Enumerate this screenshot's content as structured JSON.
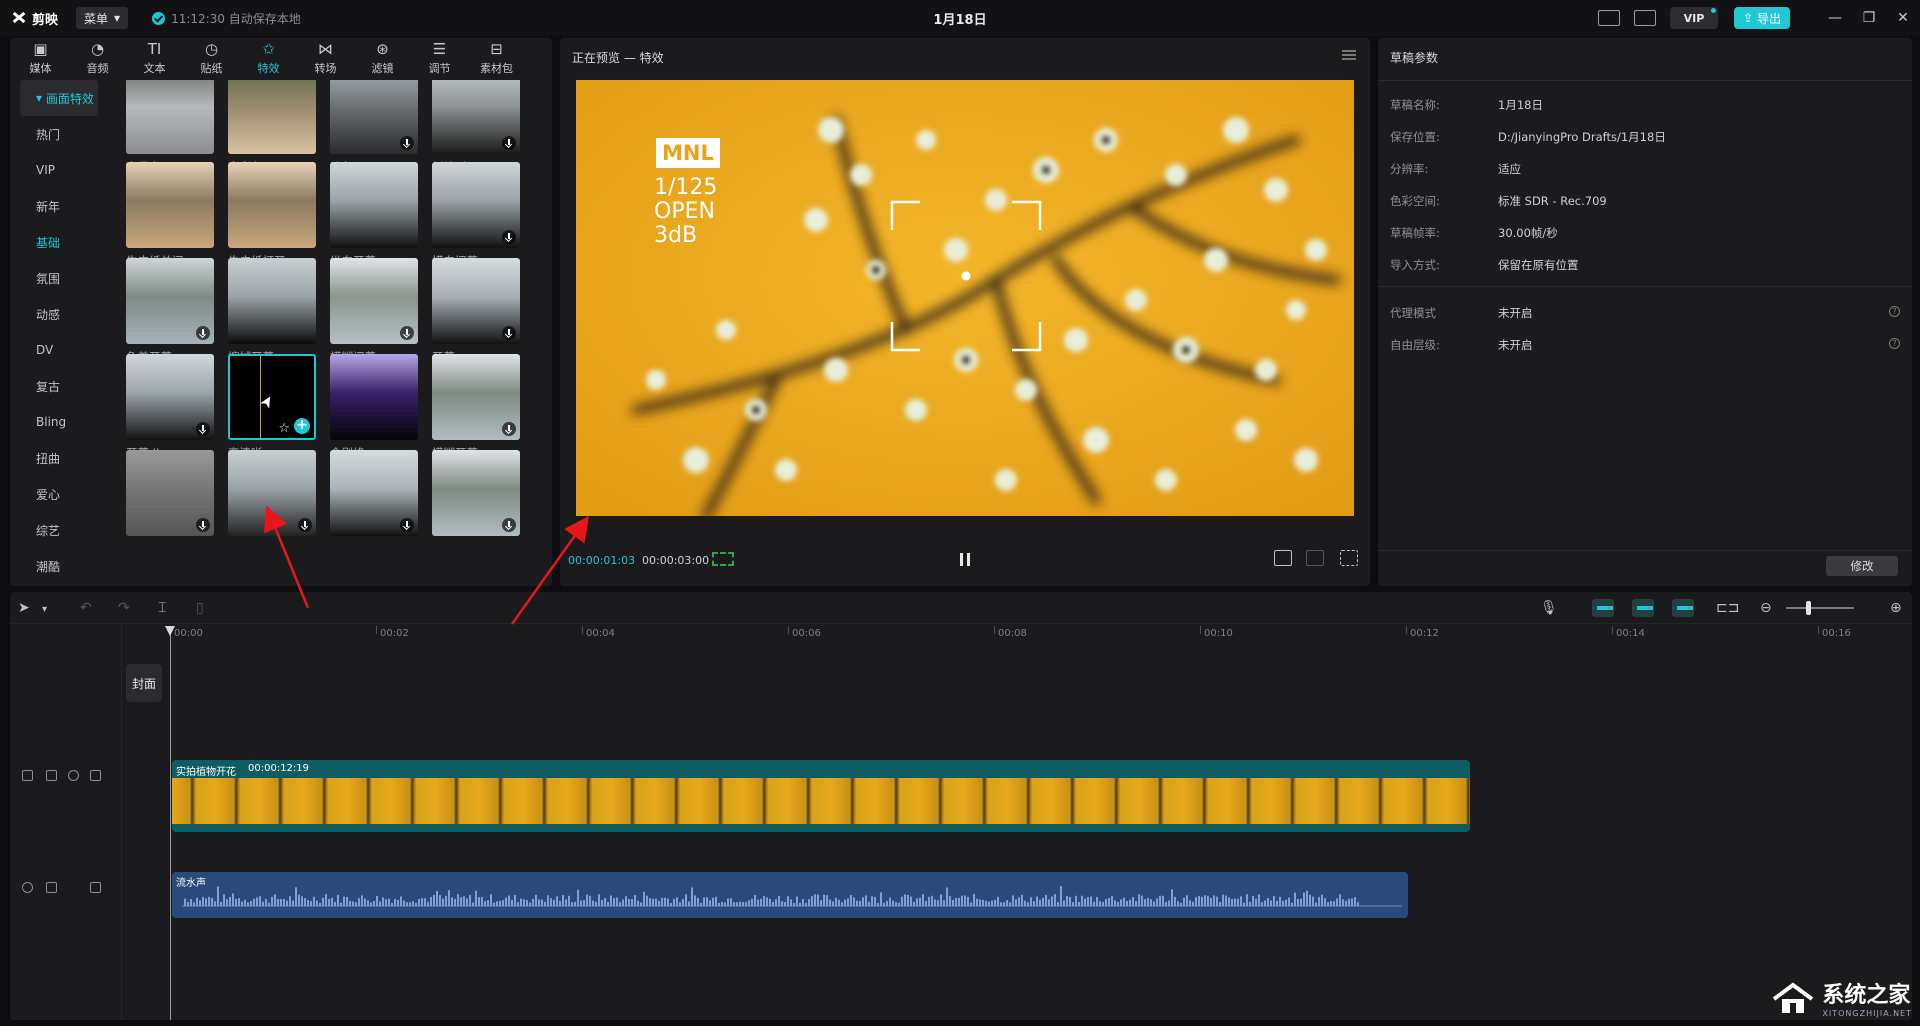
{
  "titlebar": {
    "app_name": "剪映",
    "menu_label": "菜单",
    "autosave_text": "11:12:30 自动保存本地",
    "doc_title": "1月18日",
    "vip_label": "VIP",
    "export_label": "导出"
  },
  "tool_tabs": [
    {
      "label": "媒体",
      "icon": "media-icon"
    },
    {
      "label": "音频",
      "icon": "audio-icon"
    },
    {
      "label": "文本",
      "icon": "text-icon"
    },
    {
      "label": "贴纸",
      "icon": "sticker-icon"
    },
    {
      "label": "特效",
      "icon": "effects-icon",
      "active": true
    },
    {
      "label": "转场",
      "icon": "transition-icon"
    },
    {
      "label": "滤镜",
      "icon": "filter-icon"
    },
    {
      "label": "调节",
      "icon": "adjust-icon"
    },
    {
      "label": "素材包",
      "icon": "asset-pack-icon"
    }
  ],
  "categories": {
    "selected": "画面特效",
    "items": [
      "热门",
      "VIP",
      "新年",
      "基础",
      "氛围",
      "动感",
      "DV",
      "复古",
      "Bling",
      "扭曲",
      "爱心",
      "综艺",
      "潮酷"
    ]
  },
  "effects": [
    {
      "label": "变黑白",
      "download": false
    },
    {
      "label": "变彩色",
      "download": false
    },
    {
      "label": "暗角",
      "download": true
    },
    {
      "label": "倒计时",
      "download": true
    },
    {
      "label": "牛皮纸关闭",
      "download": false
    },
    {
      "label": "牛皮纸打开",
      "download": false
    },
    {
      "label": "纵向开幕",
      "download": false
    },
    {
      "label": "横向闭幕",
      "download": true
    },
    {
      "label": "色差开幕",
      "download": true
    },
    {
      "label": "擦拭开幕",
      "download": false
    },
    {
      "label": "模糊闭幕",
      "download": true
    },
    {
      "label": "开幕",
      "download": true
    },
    {
      "label": "开幕 II",
      "download": true
    },
    {
      "label": "变清晰",
      "download": false,
      "selected": true
    },
    {
      "label": "全剧终",
      "download": false
    },
    {
      "label": "模糊开幕",
      "download": true
    },
    {
      "label": "",
      "download": true
    },
    {
      "label": "",
      "download": true
    },
    {
      "label": "",
      "download": true
    },
    {
      "label": "",
      "download": true
    }
  ],
  "preview": {
    "title": "正在预览 — 特效",
    "hud_badge": "MNL",
    "hud_lines": [
      "1/125",
      "OPEN",
      "3dB"
    ],
    "current_time": "00:00:01:03",
    "total_time": "00:00:03:00"
  },
  "params": {
    "title": "草稿参数",
    "rows": [
      {
        "label": "草稿名称:",
        "value": "1月18日"
      },
      {
        "label": "保存位置:",
        "value": "D:/JianyingPro Drafts/1月18日"
      },
      {
        "label": "分辨率:",
        "value": "适应"
      },
      {
        "label": "色彩空间:",
        "value": "标准 SDR - Rec.709"
      },
      {
        "label": "草稿帧率:",
        "value": "30.00帧/秒"
      },
      {
        "label": "导入方式:",
        "value": "保留在原有位置"
      },
      {
        "label": "代理模式",
        "value": "未开启"
      },
      {
        "label": "自由层级:",
        "value": "未开启"
      }
    ],
    "modify_label": "修改"
  },
  "timeline": {
    "ticks": [
      "00:00",
      "00:02",
      "00:04",
      "00:06",
      "00:08",
      "00:10",
      "00:12",
      "00:14",
      "00:16"
    ],
    "cover_label": "封面",
    "video_clip_name": "实拍植物开花",
    "video_clip_duration": "00:00:12:19",
    "audio_clip_name": "流水声",
    "zoom_level": 0.3
  },
  "watermark": {
    "text": "系统之家",
    "sub": "XITONGZHIJIA.NET"
  },
  "colors": {
    "accent": "#1fc8d4",
    "video_clip": "#0d5d62",
    "audio_clip": "#2b4a7c",
    "arrow": "#e8161b"
  }
}
